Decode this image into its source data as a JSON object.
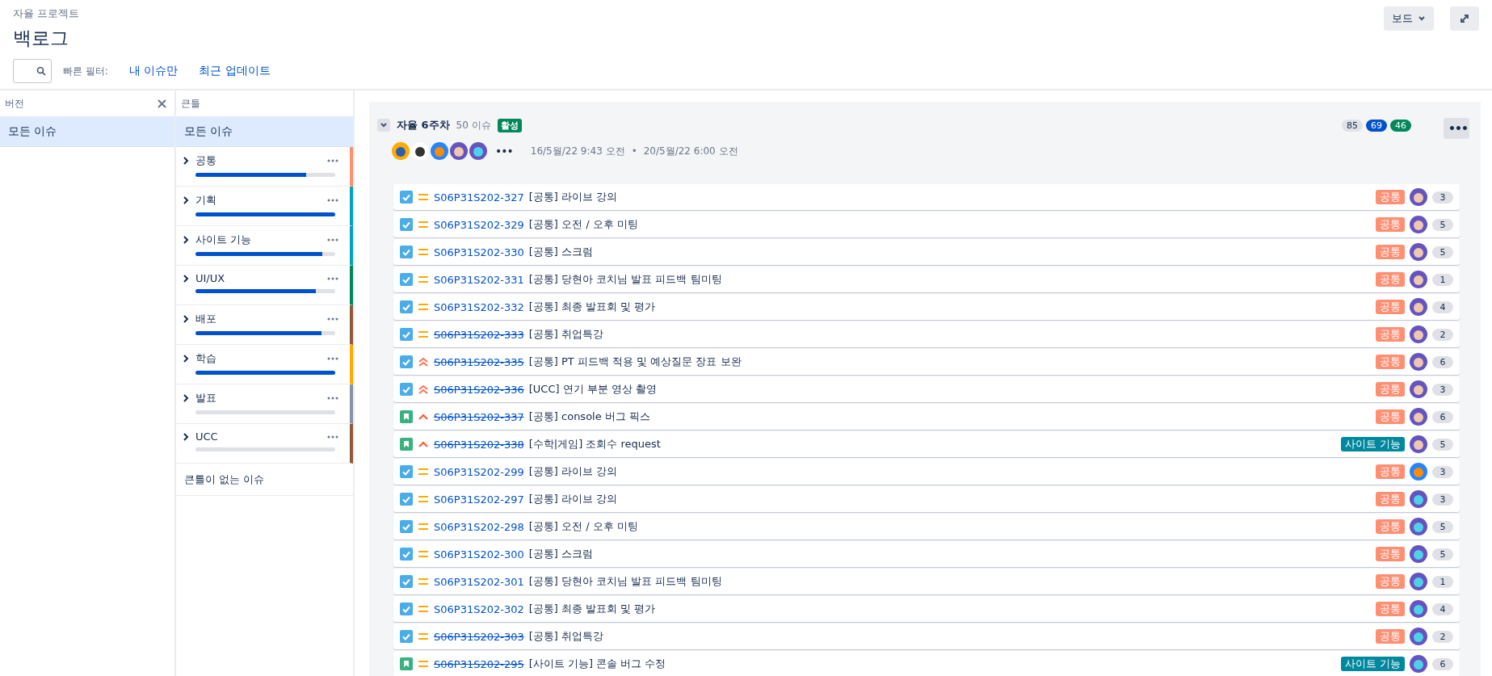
{
  "header": {
    "breadcrumb": "자율 프로젝트",
    "title": "백로그",
    "board_button": "보드"
  },
  "quick_filters": {
    "label": "빠른 필터:",
    "links": [
      "내 이슈만",
      "최근 업데이트"
    ]
  },
  "versions": {
    "title": "버전",
    "items": [
      {
        "label": "모든 이슈",
        "selected": true
      }
    ]
  },
  "epics": {
    "title": "큰틀",
    "all": {
      "label": "모든 이슈",
      "selected": true
    },
    "items": [
      {
        "name": "공통",
        "color": "#ff8f73",
        "level": 0.79
      },
      {
        "name": "기획",
        "color": "#00a3bf",
        "level": 1
      },
      {
        "name": "사이트 기능",
        "color": "#00a3bf",
        "level": 0.91
      },
      {
        "name": "UI/UX",
        "color": "#00875a",
        "level": 0.86
      },
      {
        "name": "배포",
        "color": "#8f5a37",
        "level": 0.9
      },
      {
        "name": "학습",
        "color": "#ffab00",
        "level": 1
      },
      {
        "name": "발표",
        "color": "#8993a4",
        "level": 0
      },
      {
        "name": "UCC",
        "color": "#8f5a37",
        "level": 0
      }
    ],
    "none": "큰틀이 없는 이슈"
  },
  "sprint": {
    "name": "자율 6주차",
    "count": "50 이슈",
    "status": "활성",
    "expanded": true,
    "avatars": [
      {
        "kind": "gold"
      },
      {
        "kind": "mono"
      },
      {
        "kind": "cat"
      },
      {
        "kind": "person"
      },
      {
        "kind": "owl"
      }
    ],
    "more": "•••",
    "start": "16/5월/22 9:43 오전",
    "separator": "•",
    "end": "20/5월/22 6:00 오전",
    "points": [
      {
        "value": "85",
        "kind": "todo"
      },
      {
        "value": "69",
        "kind": "progress"
      },
      {
        "value": "46",
        "kind": "done"
      }
    ],
    "issues": [
      {
        "kind": "task",
        "priority": {
          "kind": "medium"
        },
        "key": "S06P31S202-327",
        "done": false,
        "summary": "[공통] 라이브 강의",
        "epic": {
          "text": "공통",
          "color": "#ff8f73"
        },
        "assignee": {
          "kind": "person"
        },
        "points": "3"
      },
      {
        "kind": "task",
        "priority": {
          "kind": "medium"
        },
        "key": "S06P31S202-329",
        "done": false,
        "summary": "[공통] 오전 / 오후 미팅",
        "epic": {
          "text": "공통",
          "color": "#ff8f73"
        },
        "assignee": {
          "kind": "person"
        },
        "points": "5"
      },
      {
        "kind": "task",
        "priority": {
          "kind": "medium"
        },
        "key": "S06P31S202-330",
        "done": false,
        "summary": "[공통] 스크럼",
        "epic": {
          "text": "공통",
          "color": "#ff8f73"
        },
        "assignee": {
          "kind": "person"
        },
        "points": "5"
      },
      {
        "kind": "task",
        "priority": {
          "kind": "medium"
        },
        "key": "S06P31S202-331",
        "done": false,
        "summary": "[공통] 당현아 코치님 발표 피드백 팀미팅",
        "epic": {
          "text": "공통",
          "color": "#ff8f73"
        },
        "assignee": {
          "kind": "person"
        },
        "points": "1"
      },
      {
        "kind": "task",
        "priority": {
          "kind": "medium"
        },
        "key": "S06P31S202-332",
        "done": false,
        "summary": "[공통] 최종 발표회 및 평가",
        "epic": {
          "text": "공통",
          "color": "#ff8f73"
        },
        "assignee": {
          "kind": "person"
        },
        "points": "4"
      },
      {
        "kind": "task",
        "priority": {
          "kind": "medium"
        },
        "key": "S06P31S202-333",
        "done": true,
        "summary": "[공통] 취업특강",
        "epic": {
          "text": "공통",
          "color": "#ff8f73"
        },
        "assignee": {
          "kind": "person"
        },
        "points": "2"
      },
      {
        "kind": "task",
        "priority": {
          "kind": "highest"
        },
        "key": "S06P31S202-335",
        "done": true,
        "summary": "[공통] PT 피드백 적용 및 예상질문 장표 보완",
        "epic": {
          "text": "공통",
          "color": "#ff8f73"
        },
        "assignee": {
          "kind": "person"
        },
        "points": "6"
      },
      {
        "kind": "task",
        "priority": {
          "kind": "highest"
        },
        "key": "S06P31S202-336",
        "done": true,
        "summary": "[UCC] 연기 부분 영상 촬영",
        "epic": {
          "text": "공통",
          "color": "#ff8f73"
        },
        "assignee": {
          "kind": "person"
        },
        "points": "3"
      },
      {
        "kind": "story",
        "priority": {
          "kind": "high"
        },
        "key": "S06P31S202-337",
        "done": true,
        "summary": "[공통] console 버그 픽스",
        "epic": {
          "text": "공통",
          "color": "#ff8f73"
        },
        "assignee": {
          "kind": "person"
        },
        "points": "6"
      },
      {
        "kind": "story",
        "priority": {
          "kind": "high"
        },
        "key": "S06P31S202-338",
        "done": true,
        "summary": "[수학|게임] 조회수 request",
        "epic": {
          "text": "사이트 기능",
          "color": "#00899e"
        },
        "assignee": {
          "kind": "person"
        },
        "points": "5"
      },
      {
        "kind": "task",
        "priority": {
          "kind": "medium"
        },
        "key": "S06P31S202-299",
        "done": false,
        "summary": "[공통] 라이브 강의",
        "epic": {
          "text": "공통",
          "color": "#ff8f73"
        },
        "assignee": {
          "kind": "cat"
        },
        "points": "3"
      },
      {
        "kind": "task",
        "priority": {
          "kind": "medium"
        },
        "key": "S06P31S202-297",
        "done": false,
        "summary": "[공통] 라이브 강의",
        "epic": {
          "text": "공통",
          "color": "#ff8f73"
        },
        "assignee": {
          "kind": "owl"
        },
        "points": "3"
      },
      {
        "kind": "task",
        "priority": {
          "kind": "medium"
        },
        "key": "S06P31S202-298",
        "done": false,
        "summary": "[공통] 오전 / 오후 미팅",
        "epic": {
          "text": "공통",
          "color": "#ff8f73"
        },
        "assignee": {
          "kind": "owl"
        },
        "points": "5"
      },
      {
        "kind": "task",
        "priority": {
          "kind": "medium"
        },
        "key": "S06P31S202-300",
        "done": false,
        "summary": "[공통] 스크럼",
        "epic": {
          "text": "공통",
          "color": "#ff8f73"
        },
        "assignee": {
          "kind": "owl"
        },
        "points": "5"
      },
      {
        "kind": "task",
        "priority": {
          "kind": "medium"
        },
        "key": "S06P31S202-301",
        "done": false,
        "summary": "[공통] 당현아 코치님 발표 피드백 팀미팅",
        "epic": {
          "text": "공통",
          "color": "#ff8f73"
        },
        "assignee": {
          "kind": "owl"
        },
        "points": "1"
      },
      {
        "kind": "task",
        "priority": {
          "kind": "medium"
        },
        "key": "S06P31S202-302",
        "done": false,
        "summary": "[공통] 최종 발표회 및 평가",
        "epic": {
          "text": "공통",
          "color": "#ff8f73"
        },
        "assignee": {
          "kind": "owl"
        },
        "points": "4"
      },
      {
        "kind": "task",
        "priority": {
          "kind": "medium"
        },
        "key": "S06P31S202-303",
        "done": true,
        "summary": "[공통] 취업특강",
        "epic": {
          "text": "공통",
          "color": "#ff8f73"
        },
        "assignee": {
          "kind": "owl"
        },
        "points": "2"
      },
      {
        "kind": "story",
        "priority": {
          "kind": "medium"
        },
        "key": "S06P31S202-295",
        "done": true,
        "summary": "[사이트 기능] 콘솔 버그 수정",
        "epic": {
          "text": "사이트 기능",
          "color": "#00899e"
        },
        "assignee": {
          "kind": "owl"
        },
        "points": "6"
      }
    ]
  }
}
